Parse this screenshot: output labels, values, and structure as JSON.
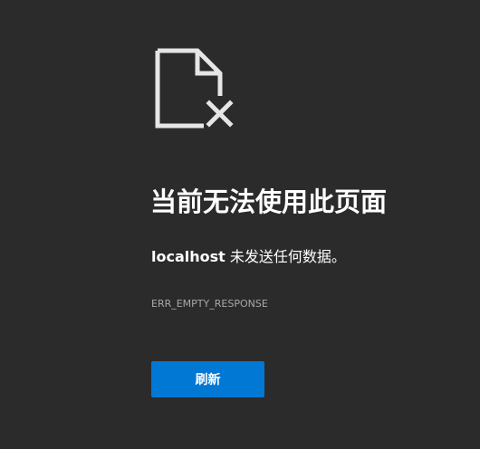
{
  "error_page": {
    "icon": "file-error-icon",
    "title": "当前无法使用此页面",
    "host": "localhost",
    "message_suffix": " 未发送任何数据。",
    "error_code": "ERR_EMPTY_RESPONSE",
    "refresh_label": "刷新"
  },
  "colors": {
    "background": "#2b2b2b",
    "text": "#ffffff",
    "muted_text": "#a8a8a8",
    "button": "#0078d4"
  }
}
